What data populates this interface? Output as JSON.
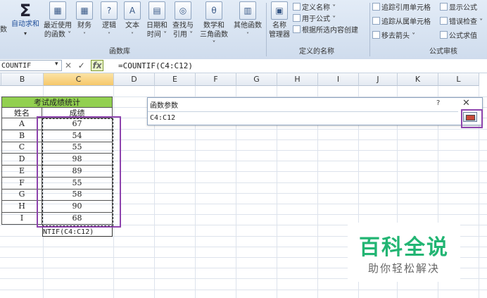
{
  "ribbon": {
    "buttons": [
      {
        "label": "数",
        "icon": "function-icon"
      },
      {
        "label": "自动求和",
        "icon": "sigma-icon"
      },
      {
        "label": "最近使用的函数",
        "icon": "recent-functions-icon"
      },
      {
        "label": "财务",
        "icon": "financial-icon"
      },
      {
        "label": "逻辑",
        "icon": "logical-icon"
      },
      {
        "label": "文本",
        "icon": "text-icon"
      },
      {
        "label": "日期和时间",
        "icon": "date-time-icon"
      },
      {
        "label": "查找与引用",
        "icon": "lookup-icon"
      },
      {
        "label": "数学和三角函数",
        "icon": "math-trig-icon"
      },
      {
        "label": "其他函数",
        "icon": "more-functions-icon"
      },
      {
        "label": "名称管理器",
        "icon": "name-manager-icon"
      }
    ],
    "btn_lines": {
      "b0": "数",
      "b1a": "自动求和",
      "b2a": "最近使用",
      "b2b": "的函数 ˅",
      "b3a": "财务",
      "b4a": "逻辑",
      "b5a": "文本",
      "b6a": "日期和",
      "b6b": "时间 ˅",
      "b7a": "查找与",
      "b7b": "引用 ˅",
      "b8a": "数学和",
      "b8b": "三角函数 ˅",
      "b9a": "其他函数",
      "b10a": "名称",
      "b10b": "管理器"
    },
    "icon_glyphs": {
      "b3": "▦",
      "b4": "?",
      "b5": "A",
      "b6": "▤",
      "b7": "◎",
      "b8": "θ",
      "b9": "▥",
      "b2": "▦",
      "b10": "▣"
    },
    "define_name": {
      "define": "定义名称 ˅",
      "use_in_formula": "用于公式 ˅",
      "create_from_selection": "根据所选内容创建"
    },
    "audit": {
      "trace_precedents": "追踪引用单元格",
      "show_formulas": "显示公式",
      "trace_dependents": "追踪从属单元格",
      "error_checking": "错误检查 ˅",
      "remove_arrows": "移去箭头 ˅",
      "evaluate_formula": "公式求值"
    },
    "groups": {
      "function_library": "函数库",
      "defined_names": "定义的名称",
      "formula_auditing": "公式审核"
    },
    "sigma_glyph": "Σ"
  },
  "formula_bar": {
    "name_box": "COUNTIF",
    "drop": "▾",
    "cancel_glyph": "✕",
    "enter_glyph": "✓",
    "fx": "fx",
    "formula": "=COUNTIF(C4:C12)"
  },
  "columns": [
    "B",
    "C",
    "D",
    "E",
    "F",
    "G",
    "H",
    "I",
    "J",
    "K",
    "L"
  ],
  "table": {
    "title": "考试成绩统计",
    "headers": [
      "姓名",
      "成绩"
    ],
    "rows": [
      [
        "A",
        "67"
      ],
      [
        "B",
        "54"
      ],
      [
        "C",
        "55"
      ],
      [
        "D",
        "98"
      ],
      [
        "E",
        "89"
      ],
      [
        "F",
        "55"
      ],
      [
        "G",
        "58"
      ],
      [
        "H",
        "90"
      ],
      [
        "I",
        "68"
      ]
    ],
    "editing_cell": "NTIF(C4:C12)"
  },
  "dialog": {
    "title": "函数参数",
    "help": "?",
    "close": "✕",
    "range_value": "C4:C12"
  },
  "watermark": {
    "title": "百科全说",
    "subtitle": "助你轻松解决"
  },
  "colors": {
    "accent_purple": "#8e44ad",
    "title_green": "#92d050",
    "watermark_green": "#22b573"
  }
}
